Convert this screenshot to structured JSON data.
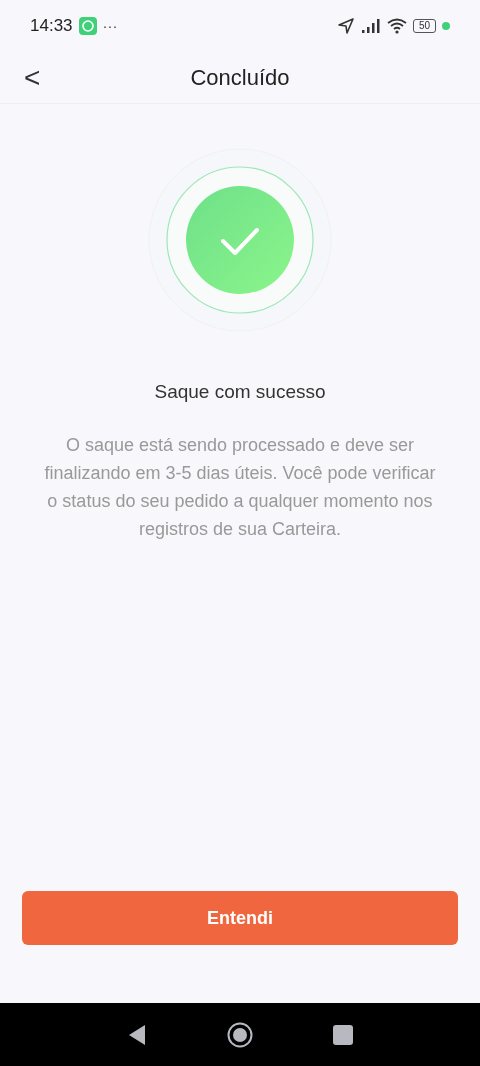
{
  "status_bar": {
    "time": "14:33",
    "more": "···",
    "battery": "50"
  },
  "header": {
    "back": "<",
    "title": "Concluído"
  },
  "result": {
    "title": "Saque com sucesso",
    "message": "O saque está sendo processado e deve ser finalizando em 3-5 dias úteis. Você pode verificar o status do seu pedido a qualquer momento nos registros de sua Carteira."
  },
  "button": "Entendi"
}
